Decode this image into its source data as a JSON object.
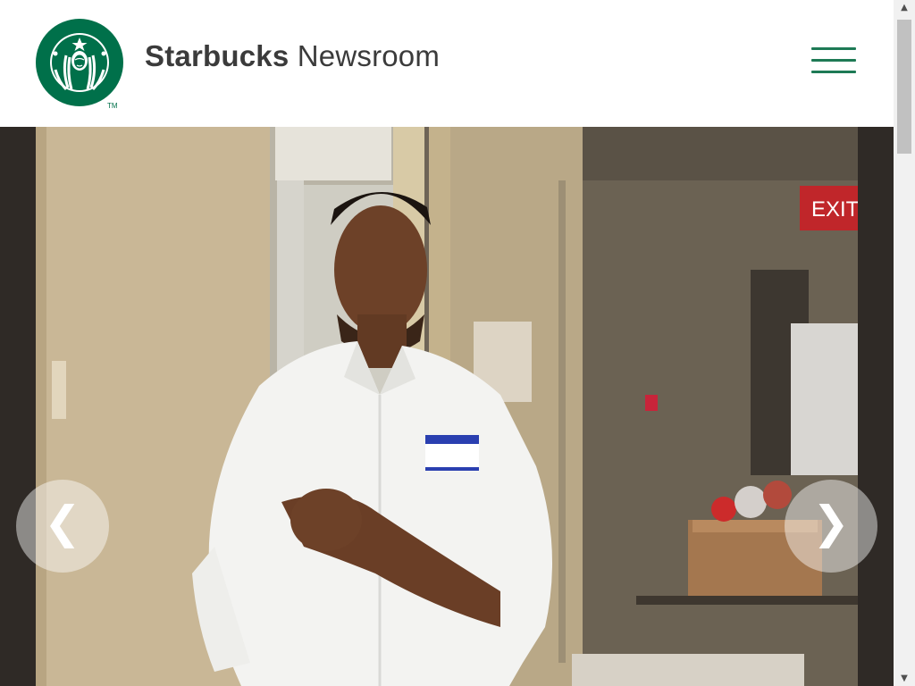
{
  "header": {
    "brand": "Starbucks",
    "section": "Newsroom",
    "logo_trademark": "TM"
  },
  "carousel": {
    "prev_glyph": "❮",
    "next_glyph": "❯",
    "slide": {
      "description_icon": "photo-man-in-white-shirt",
      "sign_text": "EXIT"
    }
  },
  "scrollbar": {
    "up_glyph": "▲",
    "down_glyph": "▼"
  },
  "colors": {
    "brand_green": "#00704a",
    "menu_green": "#1e7a55",
    "title_text": "#3b3b3b"
  }
}
